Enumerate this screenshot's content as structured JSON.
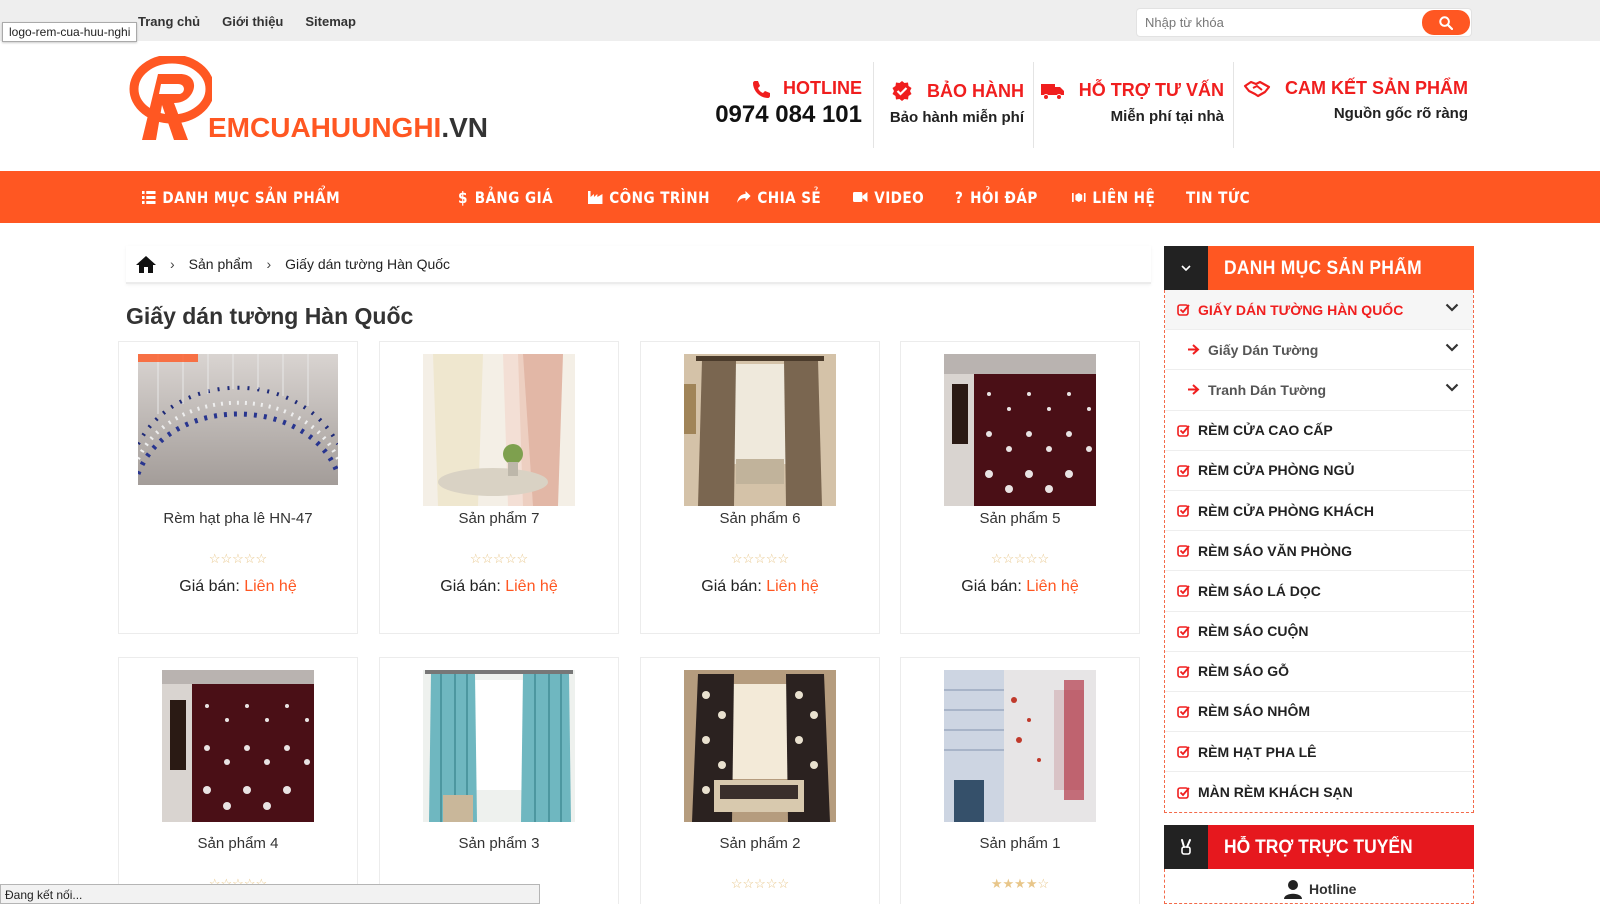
{
  "top_links": [
    "Trang chủ",
    "Giới thiệu",
    "Sitemap"
  ],
  "search": {
    "placeholder": "Nhập từ khóa"
  },
  "tooltip": "logo-rem-cua-huu-nghi",
  "logo": {
    "main": "EMCUAHUUNGHI",
    "suffix": ".VN"
  },
  "header": {
    "hotline": {
      "title": "HOTLINE",
      "number": "0974 084 101"
    },
    "warranty": {
      "title": "BẢO HÀNH",
      "sub": "Bảo hành miễn phí"
    },
    "support": {
      "title": "HỖ TRỢ TƯ VẤN",
      "sub": "Miễn phí tại nhà"
    },
    "commitment": {
      "title": "CAM KẾT SẢN PHẨM",
      "sub": "Nguồn gốc rõ ràng"
    }
  },
  "nav": {
    "catalog": "DANH MỤC SẢN PHẨM",
    "pricing": "BẢNG GIÁ",
    "projects": "CÔNG TRÌNH",
    "share": "CHIA SẺ",
    "video": "VIDEO",
    "faq": "HỎI ĐÁP",
    "contact": "LIÊN HỆ",
    "news": "TIN TỨC"
  },
  "breadcrumb": {
    "products": "Sản phẩm",
    "current": "Giấy dán tường Hàn Quốc"
  },
  "page_title": "Giấy dán tường Hàn Quốc",
  "price_label": "Giá bán:",
  "price_value": "Liên hệ",
  "products": [
    {
      "name": "Rèm hạt pha lê HN-47"
    },
    {
      "name": "Sản phẩm 7"
    },
    {
      "name": "Sản phẩm 6"
    },
    {
      "name": "Sản phẩm 5"
    },
    {
      "name": "Sản phẩm 4"
    },
    {
      "name": "Sản phẩm 3"
    },
    {
      "name": "Sản phẩm 2"
    },
    {
      "name": "Sản phẩm 1"
    }
  ],
  "sidebar": {
    "title": "DANH MỤC SẢN PHẨM",
    "items": [
      "GIẤY DÁN TƯỜNG HÀN QUỐC",
      "Giấy Dán Tường",
      "Tranh Dán Tường",
      "RÈM CỬA CAO CẤP",
      "RÈM CỬA PHÒNG NGỦ",
      "RÈM CỬA PHÒNG KHÁCH",
      "RÈM SÁO VĂN PHÒNG",
      "RÈM SÁO LÁ DỌC",
      "RÈM SÁO CUỘN",
      "RÈM SÁO GỖ",
      "RÈM SÁO NHÔM",
      "RÈM HẠT PHA LÊ",
      "MÀN RÈM KHÁCH SẠN"
    ]
  },
  "support_box": {
    "title": "HỖ TRỢ TRỰC TUYẾN",
    "hotline": "Hotline"
  },
  "status_text": "Đang kết nối...",
  "colors": {
    "accent": "#ff5722",
    "red": "#f01e1e",
    "dark": "#222222"
  }
}
